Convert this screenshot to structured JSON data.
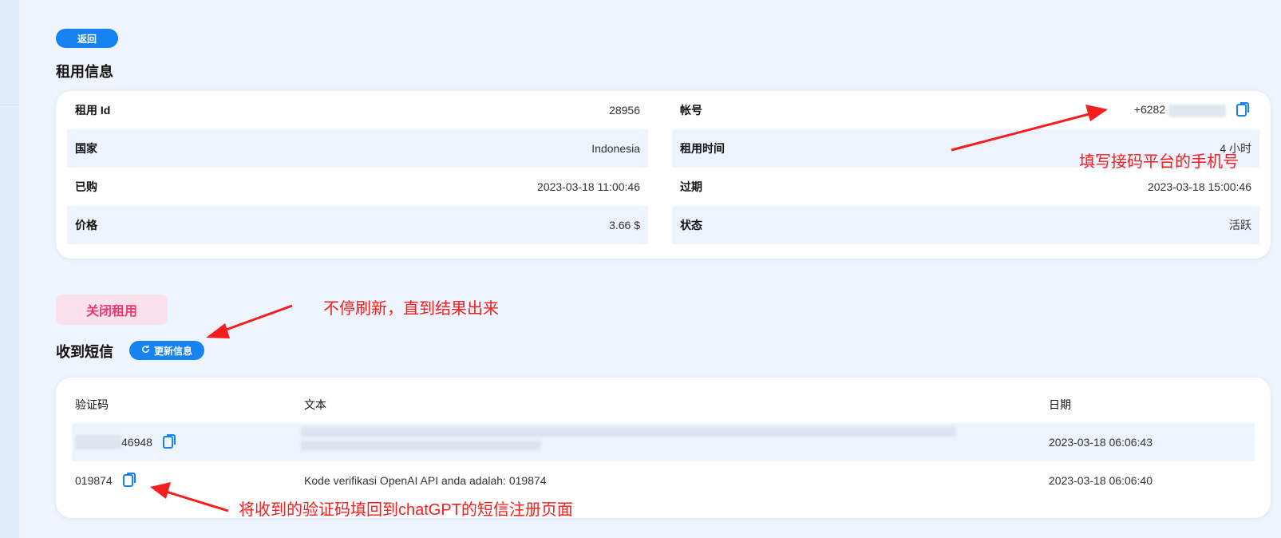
{
  "back_button": {
    "label": "返回"
  },
  "rental_section": {
    "title": "租用信息"
  },
  "rental_info": {
    "left": [
      {
        "label": "租用 Id",
        "value": "28956"
      },
      {
        "label": "国家",
        "value": "Indonesia"
      },
      {
        "label": "已购",
        "value": "2023-03-18 11:00:46"
      },
      {
        "label": "价格",
        "value": "3.66 $"
      }
    ],
    "right": [
      {
        "label": "帐号",
        "value": "+6282"
      },
      {
        "label": "租用时间",
        "value": "4 小时"
      },
      {
        "label": "过期",
        "value": "2023-03-18 15:00:46"
      },
      {
        "label": "状态",
        "value": "活跃"
      }
    ]
  },
  "close_button": {
    "label": "关闭租用"
  },
  "sms_section": {
    "title": "收到短信",
    "refresh_label": "更新信息"
  },
  "sms_table": {
    "headers": {
      "code": "验证码",
      "text": "文本",
      "date": "日期"
    },
    "rows": [
      {
        "code": "46948",
        "text": "",
        "date": "2023-03-18 06:06:43"
      },
      {
        "code": "019874",
        "text": "Kode verifikasi OpenAI API anda adalah: 019874",
        "date": "2023-03-18 06:06:40"
      }
    ]
  },
  "annotations": {
    "phone": "填写接码平台的手机号",
    "refresh": "不停刷新，直到结果出来",
    "code": "将收到的验证码填回到chatGPT的短信注册页面"
  },
  "colors": {
    "accent": "#1783f2",
    "danger": "#f2376f",
    "annotation": "#f51d1d"
  }
}
